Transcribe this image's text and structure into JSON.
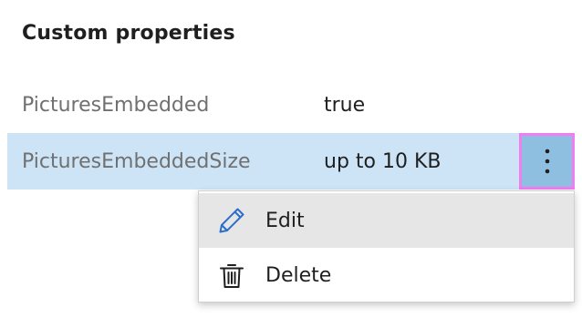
{
  "section": {
    "title": "Custom properties"
  },
  "properties": [
    {
      "name": "PicturesEmbedded",
      "value": "true"
    },
    {
      "name": "PicturesEmbeddedSize",
      "value": "up to 10 KB"
    }
  ],
  "more_button": {
    "icon": "more-vertical-icon"
  },
  "context_menu": {
    "items": [
      {
        "label": "Edit",
        "icon": "pencil-icon"
      },
      {
        "label": "Delete",
        "icon": "trash-icon"
      }
    ]
  },
  "colors": {
    "selected_row": "#cce4f6",
    "more_button_bg": "#8fbfe0",
    "focus_outline": "#f07ef0",
    "menu_hover": "#e6e6e6",
    "edit_icon": "#2b6fc9"
  }
}
